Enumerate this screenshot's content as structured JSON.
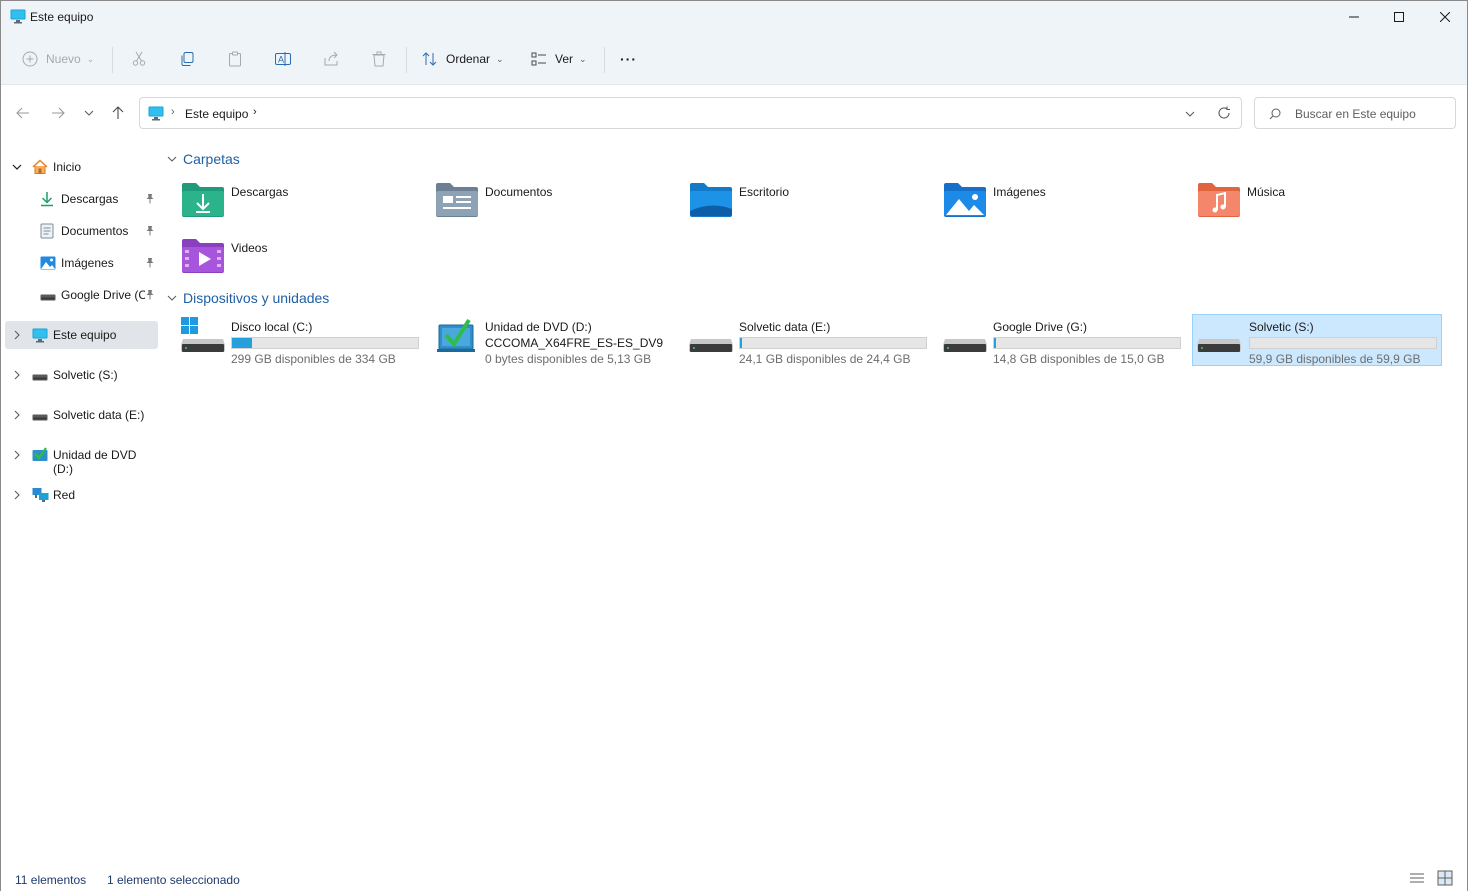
{
  "window": {
    "title": "Este equipo"
  },
  "toolbar": {
    "new_label": "Nuevo",
    "sort_label": "Ordenar",
    "view_label": "Ver",
    "more_label": "···"
  },
  "address": {
    "path_item": "Este equipo",
    "search_placeholder": "Buscar en Este equipo"
  },
  "sidebar": {
    "items": [
      {
        "label": "Inicio"
      },
      {
        "label": "Descargas"
      },
      {
        "label": "Documentos"
      },
      {
        "label": "Imágenes"
      },
      {
        "label": "Google Drive (C"
      },
      {
        "label": "Este equipo"
      },
      {
        "label": "Solvetic (S:)"
      },
      {
        "label": "Solvetic data (E:)"
      },
      {
        "label": "Unidad de DVD (D:)"
      },
      {
        "label": "Red"
      }
    ]
  },
  "groups": {
    "folders_header": "Carpetas",
    "devices_header": "Dispositivos y unidades"
  },
  "folders": [
    {
      "name": "Descargas"
    },
    {
      "name": "Documentos"
    },
    {
      "name": "Escritorio"
    },
    {
      "name": "Imágenes"
    },
    {
      "name": "Música"
    },
    {
      "name": "Videos"
    }
  ],
  "drives": [
    {
      "name": "Disco local (C:)",
      "free": "299 GB disponibles de 334 GB",
      "used_fraction": 0.105
    },
    {
      "name": "Unidad de DVD (D:)",
      "sub": "CCCOMA_X64FRE_ES-ES_DV9",
      "free": "0 bytes disponibles de 5,13 GB"
    },
    {
      "name": "Solvetic data (E:)",
      "free": "24,1 GB disponibles de 24,4 GB",
      "used_fraction": 0.012
    },
    {
      "name": "Google Drive (G:)",
      "free": "14,8 GB disponibles de 15,0 GB",
      "used_fraction": 0.013
    },
    {
      "name": "Solvetic (S:)",
      "free": "59,9 GB disponibles de 59,9 GB",
      "used_fraction": 0.0
    }
  ],
  "status": {
    "count": "11 elementos",
    "selected": "1 elemento seleccionado"
  },
  "colors": {
    "accent": "#0067c0",
    "chrome_bg": "#eff4f9",
    "drive_fill": "#26a0da",
    "selection_bg": "#cce8ff",
    "group_header": "#1f5fa6"
  }
}
